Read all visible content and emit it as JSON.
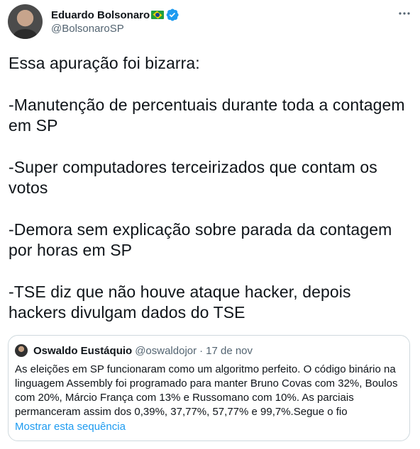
{
  "author": {
    "name": "Eduardo Bolsonaro",
    "handle": "@BolsonaroSP",
    "verified": true,
    "flag_icon": "brazil-flag-icon"
  },
  "tweet": {
    "paragraphs": [
      "Essa apuração foi bizarra:",
      "-Manutenção de percentuais durante toda a contagem em SP",
      "-Super computadores terceirizados que contam os votos",
      "-Demora sem explicação sobre parada da contagem por horas em SP",
      "-TSE diz que não houve ataque hacker, depois hackers divulgam dados do TSE"
    ]
  },
  "quoted_tweet": {
    "name": "Oswaldo Eustáquio",
    "handle": "@oswaldojor",
    "separator": "·",
    "date": "17 de nov",
    "text": "As eleições em SP funcionaram como um algoritmo perfeito. O código binário na linguagem Assembly foi programado para manter Bruno Covas com 32%, Boulos com 20%, Márcio França com 13% e Russomano com 10%. As parciais permanceram assim dos 0,39%, 37,77%, 57,77% e 99,7%.Segue o fio",
    "show_thread_label": "Mostrar esta sequência"
  },
  "colors": {
    "text": "#0f1419",
    "secondary": "#536471",
    "link": "#1d9bf0",
    "border": "#cfd9de",
    "verified": "#1d9bf0"
  }
}
